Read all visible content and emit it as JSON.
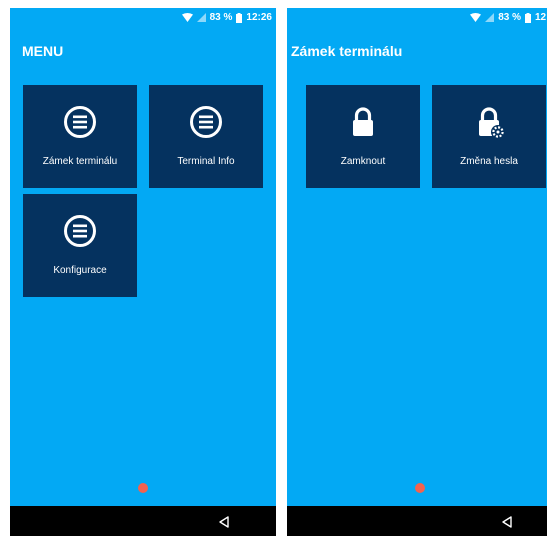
{
  "status": {
    "battery_text": "83 %",
    "time_left": "12:26",
    "time_right": "12:2"
  },
  "left_screen": {
    "title": "MENU",
    "tiles": [
      {
        "label": "Zámek terminálu",
        "icon": "menu-list-icon"
      },
      {
        "label": "Terminal Info",
        "icon": "menu-list-icon"
      },
      {
        "label": "Konfigurace",
        "icon": "menu-list-icon"
      }
    ]
  },
  "right_screen": {
    "title": "Zámek terminálu",
    "tiles": [
      {
        "label": "Zamknout",
        "icon": "lock-icon"
      },
      {
        "label": "Změna hesla",
        "icon": "lock-gear-icon"
      }
    ]
  },
  "colors": {
    "background": "#03A9F4",
    "tile": "#05325F",
    "record_dot": "#F4624E",
    "navbar": "#000000"
  }
}
